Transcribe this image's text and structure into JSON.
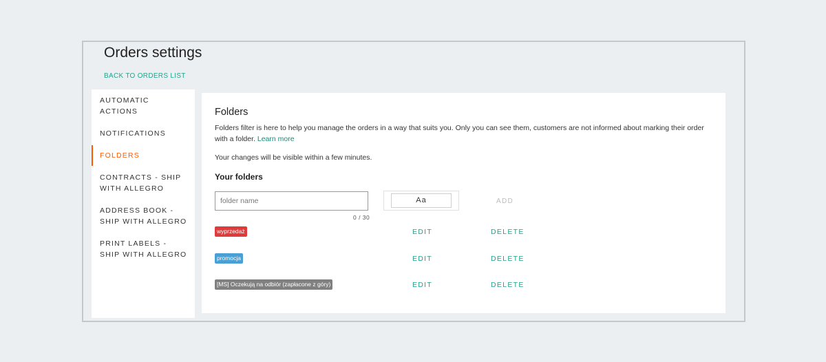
{
  "page": {
    "title": "Orders settings",
    "back_link": "BACK TO ORDERS LIST"
  },
  "sidebar": {
    "items": [
      {
        "label": "AUTOMATIC ACTIONS",
        "active": false
      },
      {
        "label": "NOTIFICATIONS",
        "active": false
      },
      {
        "label": "FOLDERS",
        "active": true
      },
      {
        "label": "CONTRACTS - SHIP WITH ALLEGRO",
        "active": false
      },
      {
        "label": "ADDRESS BOOK - SHIP WITH ALLEGRO",
        "active": false
      },
      {
        "label": "PRINT LABELS - SHIP WITH ALLEGRO",
        "active": false
      }
    ]
  },
  "folders": {
    "title": "Folders",
    "description": "Folders filter is here to help you manage the orders in a way that suits you. Only you can see them, customers are not informed about marking their order with a folder.",
    "learn_more": "Learn more",
    "note": "Your changes will be visible within a few minutes.",
    "your_folders": "Your folders",
    "input_placeholder": "folder name",
    "input_value": "",
    "counter": "0 / 30",
    "color_preview": "Aa",
    "add_label": "ADD",
    "edit_label": "EDIT",
    "delete_label": "DELETE",
    "list": [
      {
        "name": "wyprzedaż",
        "color": "#e03b3b"
      },
      {
        "name": "promocja",
        "color": "#4a9fd4"
      },
      {
        "name": "[MS] Oczekują na odbiór (zapłacone z góry)",
        "color": "#808080"
      }
    ]
  },
  "colors": {
    "accent": "#23a38b",
    "active_nav": "#ff5a00",
    "background": "#eceff2"
  }
}
